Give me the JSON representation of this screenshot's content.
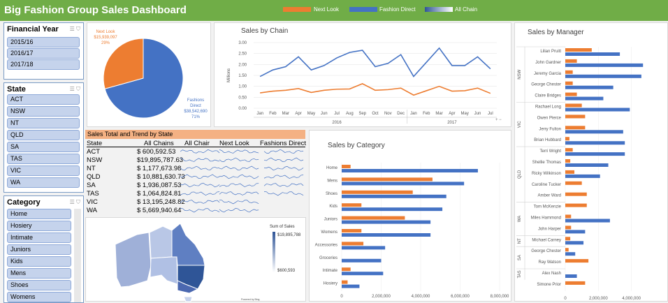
{
  "header": {
    "title": "Big Fashion Group Sales Dashboard",
    "legend": [
      "Next Look",
      "Fashion Direct",
      "All Chain"
    ],
    "colors": {
      "next_look": "#ed7d31",
      "fashion_direct": "#4472c4"
    }
  },
  "slicers": {
    "year": {
      "title": "Financial Year",
      "items": [
        "2015/16",
        "2016/17",
        "2017/18"
      ]
    },
    "state": {
      "title": "State",
      "items": [
        "ACT",
        "NSW",
        "NT",
        "QLD",
        "SA",
        "TAS",
        "VIC",
        "WA"
      ]
    },
    "category": {
      "title": "Category",
      "items": [
        "Home",
        "Hosiery",
        "Intimate",
        "Juniors",
        "Kids",
        "Mens",
        "Shoes",
        "Womens"
      ]
    }
  },
  "pie": {
    "next_look_name": "Next Look",
    "next_look_value": "$15,939,097",
    "next_look_pct": "29%",
    "fd_name_1": "Fashions",
    "fd_name_2": "Direct",
    "fd_value": "$38,542,690",
    "fd_pct": "71%"
  },
  "sales_by_chain": {
    "title": "Sales by Chain",
    "ylabel": "Millions",
    "years": [
      "2016",
      "2017"
    ]
  },
  "state_table": {
    "title": "Sales Total and Trend by State",
    "headers": [
      "State",
      "All Chains",
      "All Chair",
      "Next Look",
      "Fashions Direct"
    ],
    "rows": [
      {
        "state": "ACT",
        "total": "$ 600,592.53"
      },
      {
        "state": "NSW",
        "total": "$19,895,787.63"
      },
      {
        "state": "NT",
        "total": "$ 1,177,673.98"
      },
      {
        "state": "QLD",
        "total": "$ 10,881,630.73"
      },
      {
        "state": "SA",
        "total": "$ 1,936,087.53"
      },
      {
        "state": "TAS",
        "total": "$ 1,064,824.81"
      },
      {
        "state": "VIC",
        "total": "$ 13,195,248.82"
      },
      {
        "state": "WA",
        "total": "$ 5,669,940.64"
      }
    ]
  },
  "map": {
    "legend_title": "Sum of Sales",
    "max_label": "$19,895,788",
    "min_label": "$600,593",
    "credit": "Powered by Bing"
  },
  "chart_data": [
    {
      "type": "line",
      "title": "Sales by Chain",
      "ylabel": "Millions",
      "x": [
        "Jan",
        "Feb",
        "Mar",
        "Apr",
        "May",
        "Jun",
        "Jul",
        "Aug",
        "Sep",
        "Oct",
        "Nov",
        "Dec",
        "Jan",
        "Feb",
        "Mar",
        "Apr",
        "May",
        "Jun",
        "Jul"
      ],
      "ylim": [
        0,
        3
      ],
      "yticks": [
        "0.00",
        "0.50",
        "1.00",
        "1.50",
        "2.00",
        "2.50",
        "3.00"
      ],
      "series": [
        {
          "name": "Fashion Direct",
          "values": [
            1.45,
            1.75,
            1.9,
            2.35,
            1.75,
            1.95,
            2.3,
            2.55,
            2.65,
            1.9,
            2.05,
            2.45,
            1.45,
            2.1,
            2.75,
            1.95,
            1.95,
            2.35,
            1.8
          ]
        },
        {
          "name": "Next Look",
          "values": [
            0.7,
            0.78,
            0.82,
            0.9,
            0.72,
            0.82,
            0.87,
            0.88,
            1.12,
            0.82,
            0.85,
            0.92,
            0.6,
            0.8,
            1.0,
            0.78,
            0.8,
            0.92,
            0.68
          ]
        }
      ]
    },
    {
      "type": "bar",
      "title": "Sales by Category",
      "categories": [
        "Home",
        "Mens",
        "Shoes",
        "Kids",
        "Juniors",
        "Womens",
        "Accessories",
        "Groceries",
        "Intimate",
        "Hosiery"
      ],
      "xlim": [
        0,
        8000000
      ],
      "xticks": [
        "0",
        "2,000,000",
        "4,000,000",
        "6,000,000",
        "8,000,000"
      ],
      "series": [
        {
          "name": "Next Look",
          "values": [
            450000,
            4600000,
            3600000,
            1000000,
            3200000,
            1000000,
            1100000,
            0,
            450000,
            300000
          ]
        },
        {
          "name": "Fashion Direct",
          "values": [
            6900000,
            6200000,
            5300000,
            5100000,
            4500000,
            4500000,
            2200000,
            2000000,
            2100000,
            900000
          ]
        }
      ]
    },
    {
      "type": "bar",
      "title": "Sales by Manager",
      "categories": [
        "Lilian Pruitt",
        "John Gardner",
        "Jeremy Garcia",
        "George Chester",
        "Claire Bridges",
        "Rachael Long",
        "Owen Pierce",
        "Jerry Fulton",
        "Brian Hubbard",
        "Terri Wright",
        "Shellie Thomas",
        "Ricky Wilkinson",
        "Caroline Tucker",
        "Amber Ward",
        "Tom McKenzie",
        "Miles Hammond",
        "John Harper",
        "Michael Carney",
        "George Chester",
        "Ray Watson",
        "Alex Nash",
        "Simone Prior"
      ],
      "groups": [
        {
          "name": "NSW",
          "count": 5
        },
        {
          "name": "VIC",
          "count": 4
        },
        {
          "name": "QLD",
          "count": 5
        },
        {
          "name": "WA",
          "count": 3
        },
        {
          "name": "NT",
          "count": 1
        },
        {
          "name": "SA",
          "count": 2
        },
        {
          "name": "TAS",
          "count": 1
        }
      ],
      "xlim": [
        0,
        6000000
      ],
      "xticks": [
        "0",
        "2,000,000",
        "4,000,000"
      ],
      "series": [
        {
          "name": "Next Look",
          "values": [
            1600000,
            700000,
            450000,
            450000,
            700000,
            1000000,
            1200000,
            1200000,
            250000,
            450000,
            300000,
            550000,
            1000000,
            1300000,
            1300000,
            350000,
            350000,
            300000,
            200000,
            1400000,
            0,
            1200000
          ]
        },
        {
          "name": "Fashion Direct",
          "values": [
            3300000,
            4700000,
            4600000,
            2900000,
            2300000,
            3900000,
            0,
            3500000,
            3600000,
            3600000,
            2600000,
            2100000,
            0,
            0,
            0,
            2700000,
            1200000,
            1100000,
            600000,
            0,
            700000,
            0
          ]
        }
      ]
    }
  ]
}
